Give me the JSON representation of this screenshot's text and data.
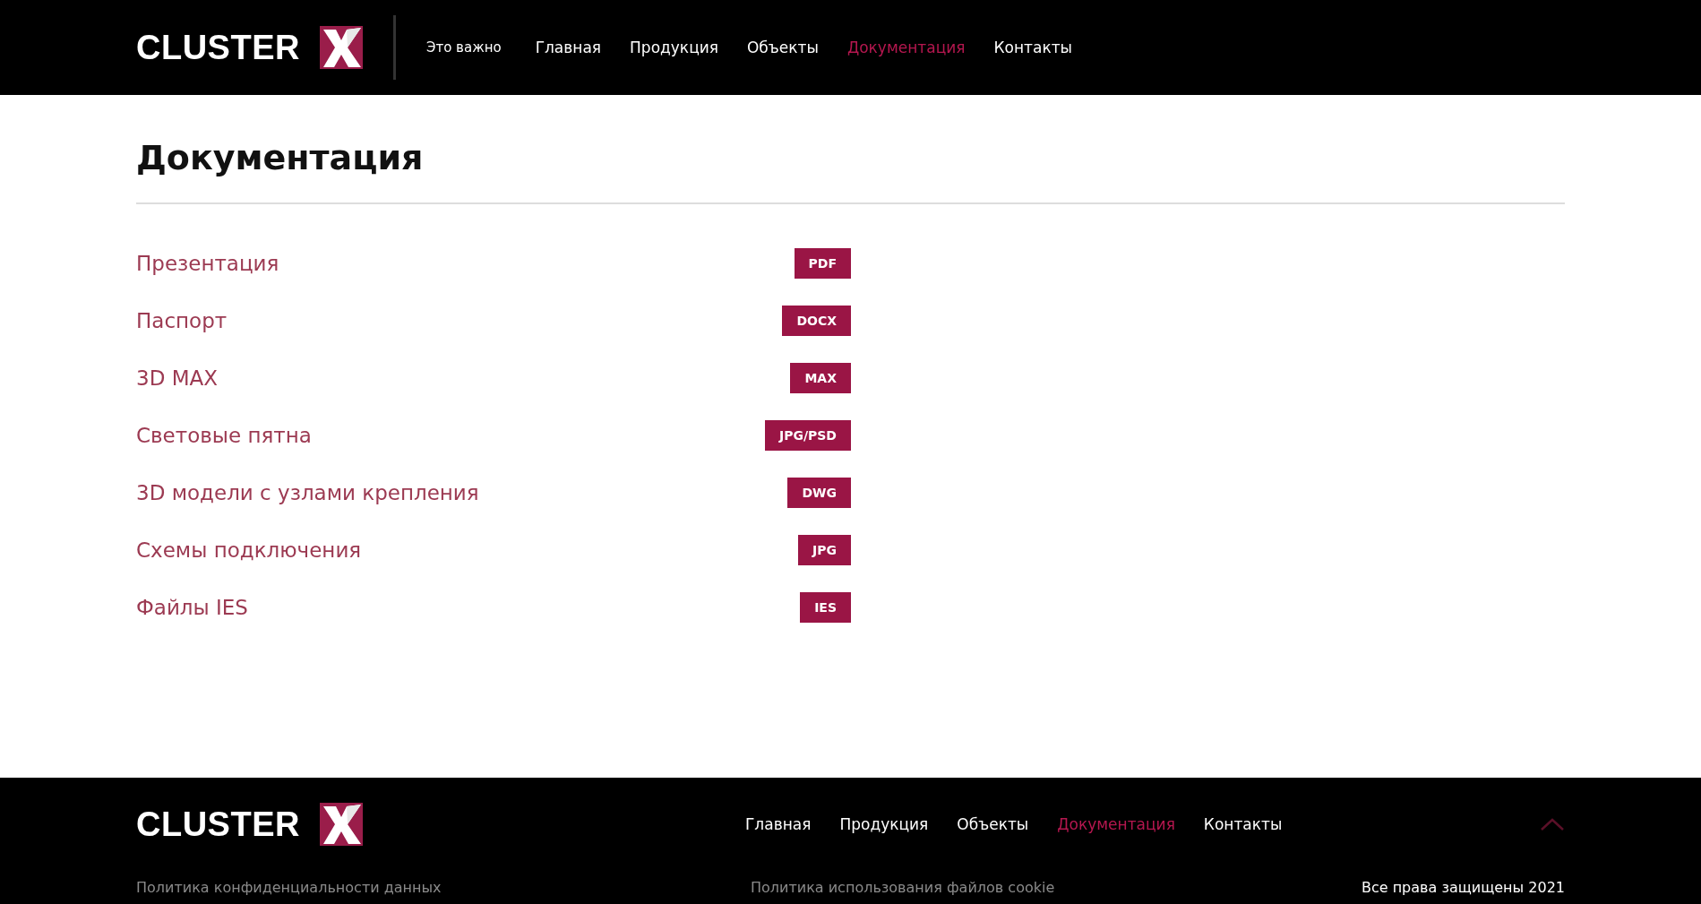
{
  "header": {
    "logo": "CLUSTER",
    "nav": [
      {
        "label": "Это важно",
        "selected": false
      },
      {
        "label": "Главная",
        "selected": false
      },
      {
        "label": "Продукция",
        "selected": false
      },
      {
        "label": "Объекты",
        "selected": false
      },
      {
        "label": "Документация",
        "selected": true
      },
      {
        "label": "Контакты",
        "selected": false
      }
    ]
  },
  "page_title": "Документация",
  "documents": [
    {
      "title": "Презентация",
      "format": "PDF"
    },
    {
      "title": "Паспорт",
      "format": "DOCX"
    },
    {
      "title": "3D MAX",
      "format": "MAX"
    },
    {
      "title": "Световые пятна",
      "format": "JPG/PSD"
    },
    {
      "title": "3D модели с узлами крепления",
      "format": "DWG"
    },
    {
      "title": "Схемы подключения",
      "format": "JPG"
    },
    {
      "title": "Файлы IES",
      "format": "IES"
    }
  ],
  "footer": {
    "logo": "CLUSTER",
    "nav": [
      {
        "label": "Главная",
        "selected": false
      },
      {
        "label": "Продукция",
        "selected": false
      },
      {
        "label": "Объекты",
        "selected": false
      },
      {
        "label": "Документация",
        "selected": true
      },
      {
        "label": "Контакты",
        "selected": false
      }
    ],
    "privacy_link": "Политика конфиденциальности данных",
    "cookie_link": "Политика использования файлов cookie",
    "copyright": "Все права защищены 2021"
  }
}
